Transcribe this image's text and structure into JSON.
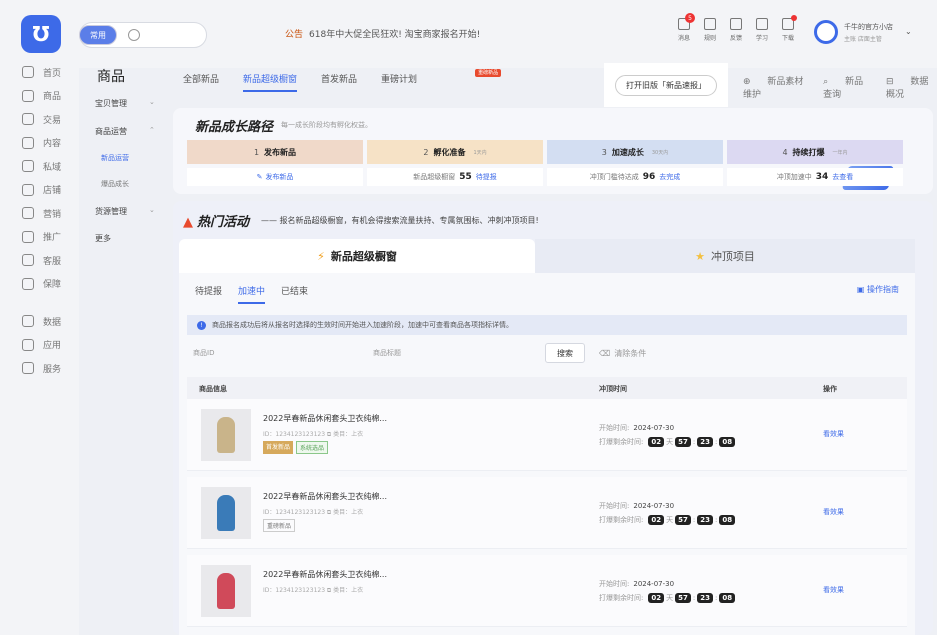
{
  "colors": {
    "accent": "#3d6ae8",
    "hot": "#e84a2e",
    "page_bg": "#eef0f5"
  },
  "logo": {
    "glyph": "Ʊ"
  },
  "left_nav": [
    {
      "label": "首页",
      "icon": "home-icon"
    },
    {
      "label": "商品",
      "icon": "product-icon"
    },
    {
      "label": "交易",
      "icon": "trade-icon"
    },
    {
      "label": "内容",
      "icon": "content-icon"
    },
    {
      "label": "私域",
      "icon": "private-icon"
    },
    {
      "label": "店铺",
      "icon": "shop-icon"
    },
    {
      "label": "营销",
      "icon": "marketing-icon"
    },
    {
      "label": "推广",
      "icon": "promote-icon"
    },
    {
      "label": "客服",
      "icon": "service-icon"
    },
    {
      "label": "保障",
      "icon": "shield-icon"
    },
    {
      "label": "数据",
      "icon": "data-icon"
    },
    {
      "label": "应用",
      "icon": "apps-icon"
    },
    {
      "label": "服务",
      "icon": "grid-icon"
    }
  ],
  "topbar": {
    "tag": "常用",
    "notice_label": "公告",
    "notice_text": "618年中大促全民狂欢! 淘宝商家报名开始!",
    "tools": [
      {
        "label": "消息",
        "badge": "5"
      },
      {
        "label": "规则"
      },
      {
        "label": "反馈"
      },
      {
        "label": "学习"
      },
      {
        "label": "下载"
      }
    ],
    "user_name": "千牛的官方小店",
    "user_role": "主账 店面主管",
    "caret": "⌄"
  },
  "subnav": {
    "title": "商品",
    "groups": [
      {
        "label": "宝贝管理",
        "arrow": "⌄"
      },
      {
        "label": "商品运营",
        "arrow": "⌃"
      },
      {
        "label": "货源管理",
        "arrow": "⌄"
      },
      {
        "label": "更多"
      }
    ],
    "items": [
      {
        "label": "新品运营"
      },
      {
        "label": "爆品成长"
      }
    ]
  },
  "tabs": [
    {
      "label": "全部新品"
    },
    {
      "label": "新品超级橱窗"
    },
    {
      "label": "首发新品"
    },
    {
      "label": "重磅计划",
      "badge": "重磅新品"
    }
  ],
  "old_version": "打开旧版「新品速报」",
  "right_links": [
    "新品素材维护",
    "新品查询",
    "数据概况"
  ],
  "growth": {
    "title": "新品成长路径",
    "subtitle": "每一成长阶段均有孵化权益。",
    "steps": [
      {
        "num": "1",
        "label": "发布新品"
      },
      {
        "num": "2",
        "label": "孵化准备",
        "note": "1天内"
      },
      {
        "num": "3",
        "label": "加速成长",
        "note": "30天内"
      },
      {
        "num": "4",
        "label": "持续打爆",
        "note": "一年内"
      }
    ],
    "metrics": [
      {
        "prefix": "发布新品"
      },
      {
        "prefix": "新品超级橱窗",
        "value": "55",
        "link": "待提报"
      },
      {
        "prefix": "冲顶门槛待达成",
        "value": "96",
        "link": "去完成"
      },
      {
        "prefix": "冲顶加速中",
        "value": "34",
        "link": "去查看"
      }
    ]
  },
  "hot": {
    "title": "热门活动",
    "desc": "—— 报名新品超级橱窗，有机会得搜索流量扶持、专属氛围标、冲刺冲顶项目!",
    "seg_active": "新品超级橱窗",
    "seg_other": "冲顶项目"
  },
  "panel": {
    "tabs": [
      "待提报",
      "加速中",
      "已结束"
    ],
    "guide": "操作指南",
    "info": "商品报名成功后将从报名时选择的生效时间开始进入加速阶段，加速中可查看商品各项指标详情。",
    "filter_id": "商品ID",
    "filter_title": "商品标题",
    "search_btn": "搜索",
    "clear_btn": "清除条件",
    "headers": [
      "商品信息",
      "冲顶时间",
      "操作"
    ]
  },
  "rows": [
    {
      "name": "2022早春新品休闲套头卫衣纯棉...",
      "id": "ID：1234123123123 ⧉  类目：上衣",
      "badges": [
        "首发新品",
        "系统选品"
      ],
      "start_label": "开始时间:",
      "start": "2024-07-30",
      "remain_label": "打爆剩余时间:",
      "cd": [
        "02",
        "57",
        "23",
        "08"
      ],
      "cd_units": [
        "天",
        ":",
        ":"
      ],
      "action": "看效果",
      "color": "#c9b48a"
    },
    {
      "name": "2022早春新品休闲套头卫衣纯棉...",
      "id": "ID：1234123123123 ⧉  类目：上衣",
      "badges": [
        "重磅新品"
      ],
      "start_label": "开始时间:",
      "start": "2024-07-30",
      "remain_label": "打爆剩余时间:",
      "cd": [
        "02",
        "57",
        "23",
        "08"
      ],
      "cd_units": [
        "天",
        ":",
        ":"
      ],
      "action": "看效果",
      "color": "#3a7bb8"
    },
    {
      "name": "2022早春新品休闲套头卫衣纯棉...",
      "id": "ID：1234123123123 ⧉  类目：上衣",
      "badges": [],
      "start_label": "开始时间:",
      "start": "2024-07-30",
      "remain_label": "打爆剩余时间:",
      "cd": [
        "02",
        "57",
        "23",
        "08"
      ],
      "cd_units": [
        "天",
        ":",
        ":"
      ],
      "action": "看效果",
      "color": "#d04a5a"
    }
  ]
}
